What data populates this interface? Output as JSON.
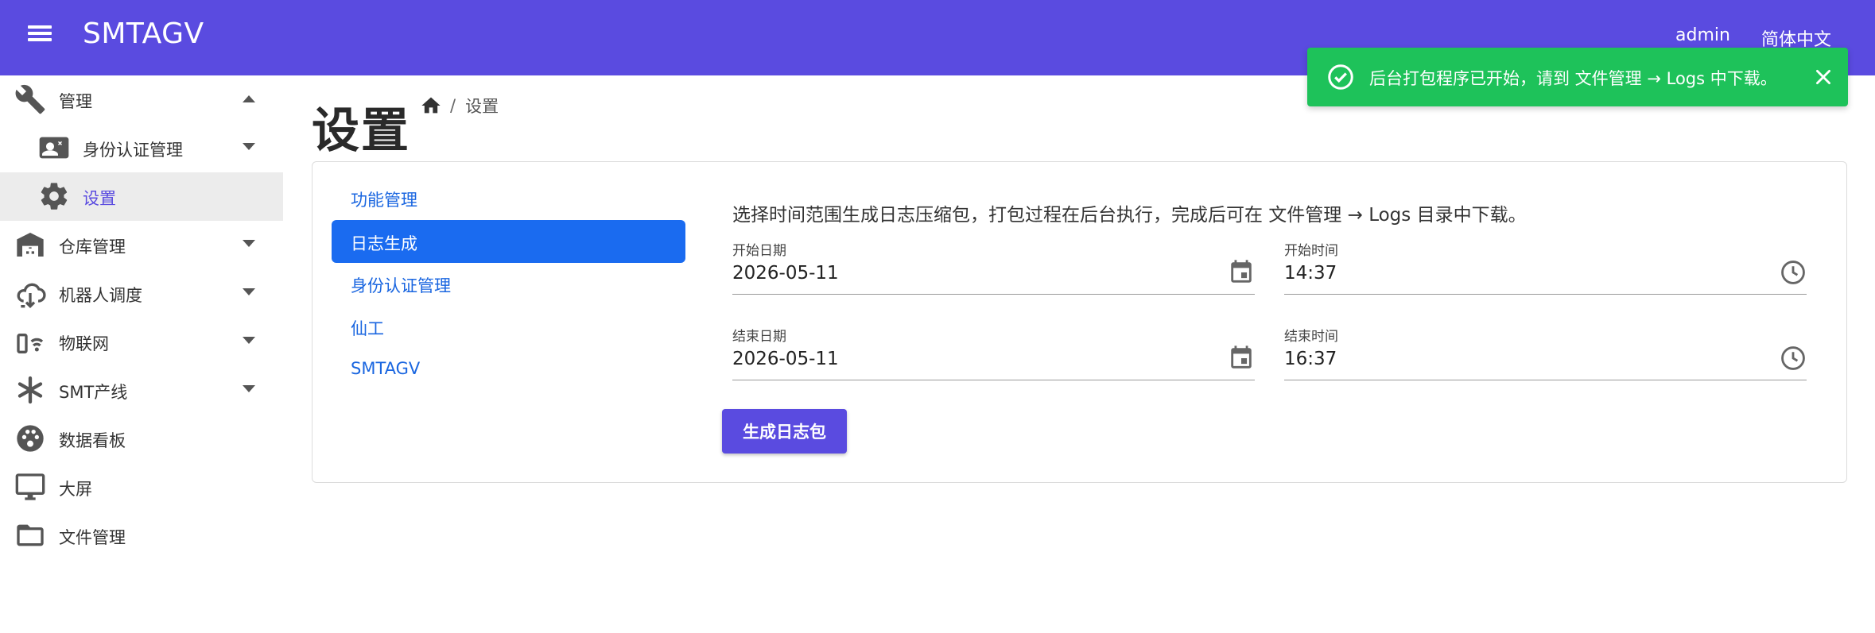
{
  "header": {
    "menu_icon": "hamburger-menu-icon",
    "app_title": "SMTAGV",
    "user": "admin",
    "language": "简体中文"
  },
  "sidebar": {
    "items": [
      {
        "label": "管理",
        "icon": "wrench-icon",
        "caret": "up"
      },
      {
        "label": "身份认证管理",
        "icon": "id-card-icon",
        "caret": "down"
      },
      {
        "label": "设置",
        "icon": "gear-icon",
        "active": true
      },
      {
        "label": "仓库管理",
        "icon": "warehouse-icon",
        "caret": "down"
      },
      {
        "label": "机器人调度",
        "icon": "robot-dispatch-icon",
        "caret": "down"
      },
      {
        "label": "物联网",
        "icon": "iot-icon",
        "caret": "down"
      },
      {
        "label": "SMT产线",
        "icon": "asterisk-icon",
        "caret": "down"
      },
      {
        "label": "数据看板",
        "icon": "palette-dashboard-icon"
      },
      {
        "label": "大屏",
        "icon": "monitor-icon"
      },
      {
        "label": "文件管理",
        "icon": "folder-icon"
      }
    ]
  },
  "page": {
    "title": "设置",
    "breadcrumb_sep": "/",
    "breadcrumb_current": "设置"
  },
  "settings_tabs": [
    {
      "label": "功能管理"
    },
    {
      "label": "日志生成",
      "active": true
    },
    {
      "label": "身份认证管理"
    },
    {
      "label": "仙工"
    },
    {
      "label": "SMTAGV"
    }
  ],
  "log_form": {
    "description": "选择时间范围生成日志压缩包，打包过程在后台执行，完成后可在 文件管理 → Logs 目录中下载。",
    "start_date_label": "开始日期",
    "start_date": "2026-05-11",
    "start_time_label": "开始时间",
    "start_time": "14:37",
    "end_date_label": "结束日期",
    "end_date": "2026-05-11",
    "end_time_label": "结束时间",
    "end_time": "16:37",
    "generate_button": "生成日志包"
  },
  "toast": {
    "message": "后台打包程序已开始，请到 文件管理 → Logs 中下载。",
    "color": "#1ec25a"
  },
  "colors": {
    "primary": "#5a4be0",
    "tab_active": "#1a6bf0",
    "link": "#1a66e0"
  }
}
